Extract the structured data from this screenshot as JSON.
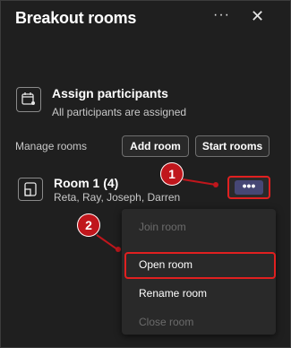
{
  "header": {
    "title": "Breakout rooms",
    "more_label": "···",
    "close_label": "✕"
  },
  "assign": {
    "title": "Assign participants",
    "subtitle": "All participants are assigned"
  },
  "manage": {
    "label": "Manage rooms",
    "add_room": "Add room",
    "start_rooms": "Start rooms"
  },
  "room": {
    "name": "Room  1 (4)",
    "members": "Reta, Ray, Joseph, Darren",
    "more_label": "•••"
  },
  "callouts": [
    "1",
    "2"
  ],
  "context_menu": {
    "items": [
      "Join room",
      "Open room",
      "Rename room",
      "Close room"
    ]
  },
  "colors": {
    "background": "#1f1f1f",
    "highlight_red": "#e02020",
    "callout_red": "#c0161c",
    "accent": "#464775"
  }
}
